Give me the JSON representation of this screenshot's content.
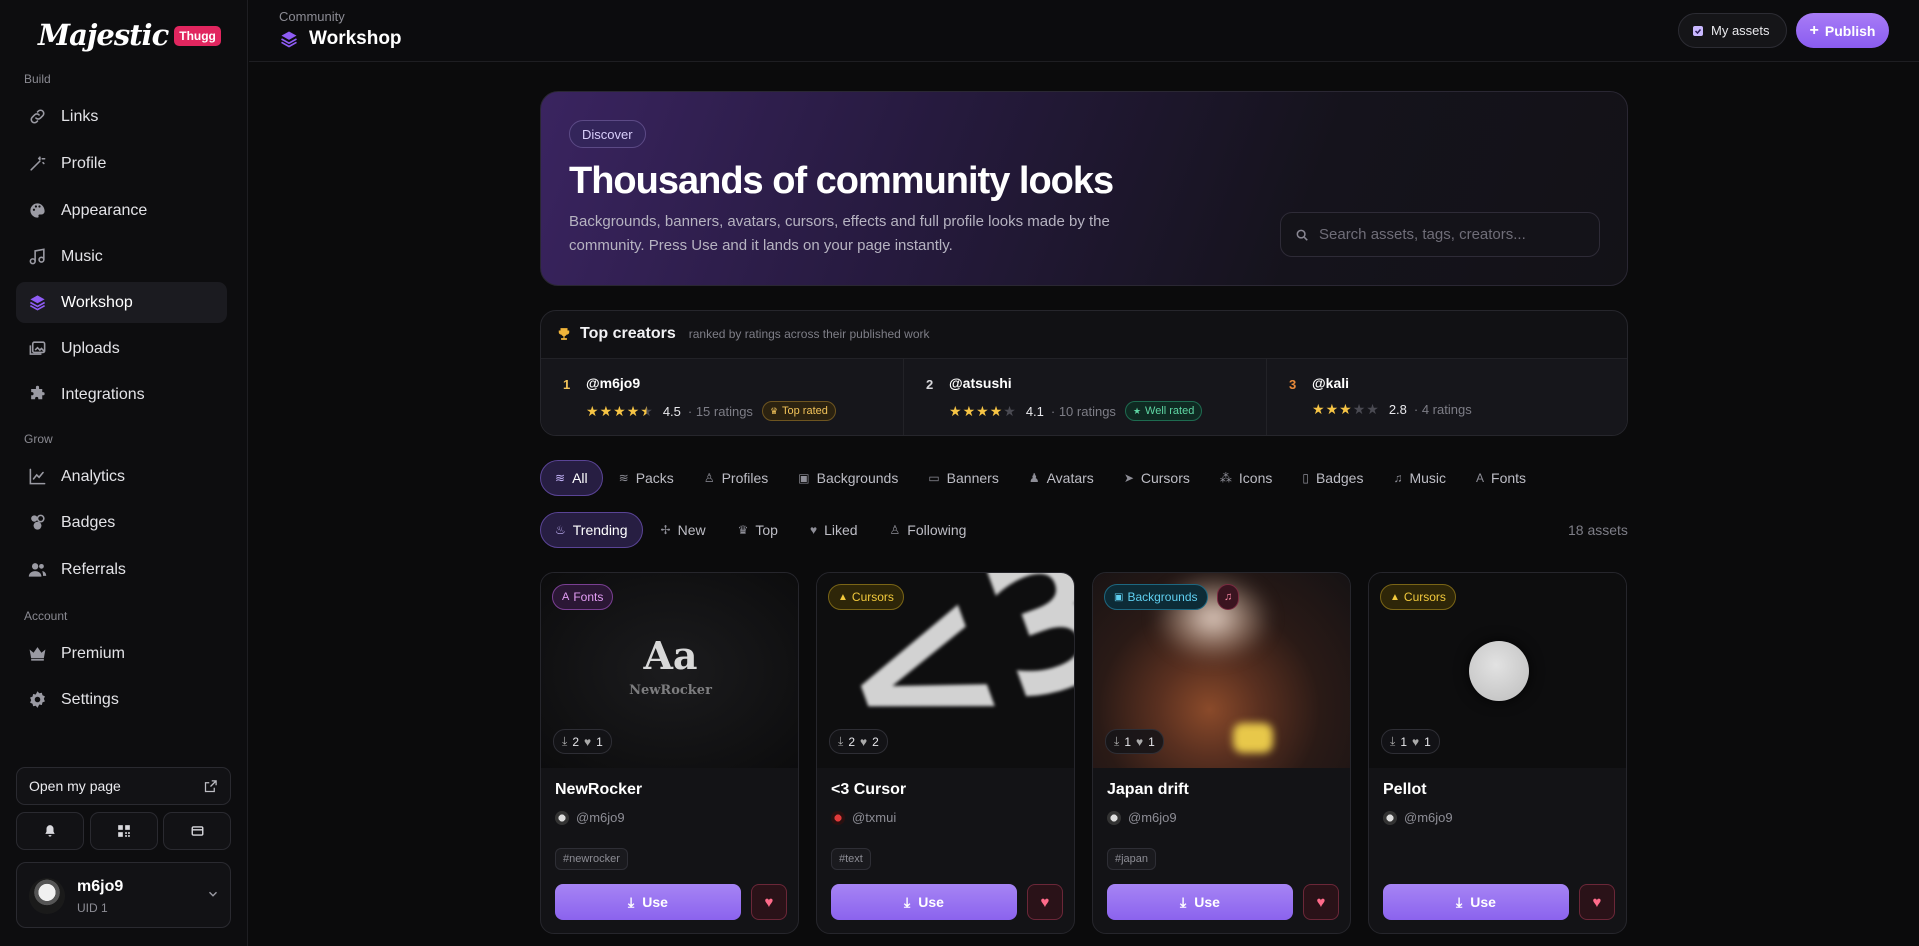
{
  "brand": {
    "name": "Majestic",
    "badge": "Thugg"
  },
  "sidebar": {
    "sections": {
      "build": "Build",
      "grow": "Grow",
      "account": "Account"
    },
    "items": [
      {
        "label": "Links",
        "icon": "link-icon"
      },
      {
        "label": "Profile",
        "icon": "wand-icon"
      },
      {
        "label": "Appearance",
        "icon": "palette-icon"
      },
      {
        "label": "Music",
        "icon": "music-note-icon"
      },
      {
        "label": "Workshop",
        "icon": "layers-icon",
        "active": true
      },
      {
        "label": "Uploads",
        "icon": "image-stack-icon"
      },
      {
        "label": "Integrations",
        "icon": "puzzle-icon"
      },
      {
        "label": "Analytics",
        "icon": "line-chart-icon"
      },
      {
        "label": "Badges",
        "icon": "badges-icon"
      },
      {
        "label": "Referrals",
        "icon": "users-icon"
      },
      {
        "label": "Premium",
        "icon": "crown-icon"
      },
      {
        "label": "Settings",
        "icon": "gear-icon"
      }
    ],
    "open_page": "Open my page",
    "user": {
      "name": "m6jo9",
      "uid": "UID 1"
    }
  },
  "topbar": {
    "breadcrumb": "Community",
    "title": "Workshop",
    "my_assets": "My assets",
    "publish": "Publish"
  },
  "hero": {
    "chip": "Discover",
    "heading": "Thousands of community looks",
    "description": "Backgrounds, banners, avatars, cursors, effects and full profile looks made by the community. Press Use and it lands on your page instantly.",
    "search_placeholder": "Search assets, tags, creators..."
  },
  "top_creators": {
    "title": "Top creators",
    "subtitle": "ranked by ratings across their published work",
    "list": [
      {
        "rank": "1",
        "handle": "@m6jo9",
        "stars": 4.5,
        "rating": "4.5",
        "count": "· 15 ratings",
        "badge": "Top rated",
        "rank_color": "#f2c35a"
      },
      {
        "rank": "2",
        "handle": "@atsushi",
        "stars": 4,
        "rating": "4.1",
        "count": "· 10 ratings",
        "badge": "Well rated",
        "rank_color": "#d8d8dc"
      },
      {
        "rank": "3",
        "handle": "@kali",
        "stars": 3,
        "rating": "2.8",
        "count": "· 4 ratings",
        "badge": "",
        "rank_color": "#e98a3a"
      }
    ]
  },
  "filters": [
    "All",
    "Packs",
    "Profiles",
    "Backgrounds",
    "Banners",
    "Avatars",
    "Cursors",
    "Icons",
    "Badges",
    "Music",
    "Fonts"
  ],
  "sorts": [
    "Trending",
    "New",
    "Top",
    "Liked",
    "Following"
  ],
  "asset_count": "18 assets",
  "cards": [
    {
      "tag": "Fonts",
      "downloads": "2",
      "likes": "1",
      "name": "NewRocker",
      "author": "@m6jo9",
      "hashtag": "#newrocker",
      "use": "Use",
      "thumb_big": "Aa",
      "thumb_small": "NewRocker"
    },
    {
      "tag": "Cursors",
      "downloads": "2",
      "likes": "2",
      "name": "<3 Cursor",
      "author": "@txmui",
      "hashtag": "#text",
      "use": "Use",
      "thumb_big": "<3"
    },
    {
      "tag": "Backgrounds",
      "downloads": "1",
      "likes": "1",
      "name": "Japan drift",
      "author": "@m6jo9",
      "hashtag": "#japan",
      "use": "Use"
    },
    {
      "tag": "Cursors",
      "downloads": "1",
      "likes": "1",
      "name": "Pellot",
      "author": "@m6jo9",
      "hashtag": "",
      "use": "Use"
    }
  ],
  "colors": {
    "accent": "#9a6ff2",
    "gold": "#f6c445",
    "brand_badge": "#e1265f"
  }
}
